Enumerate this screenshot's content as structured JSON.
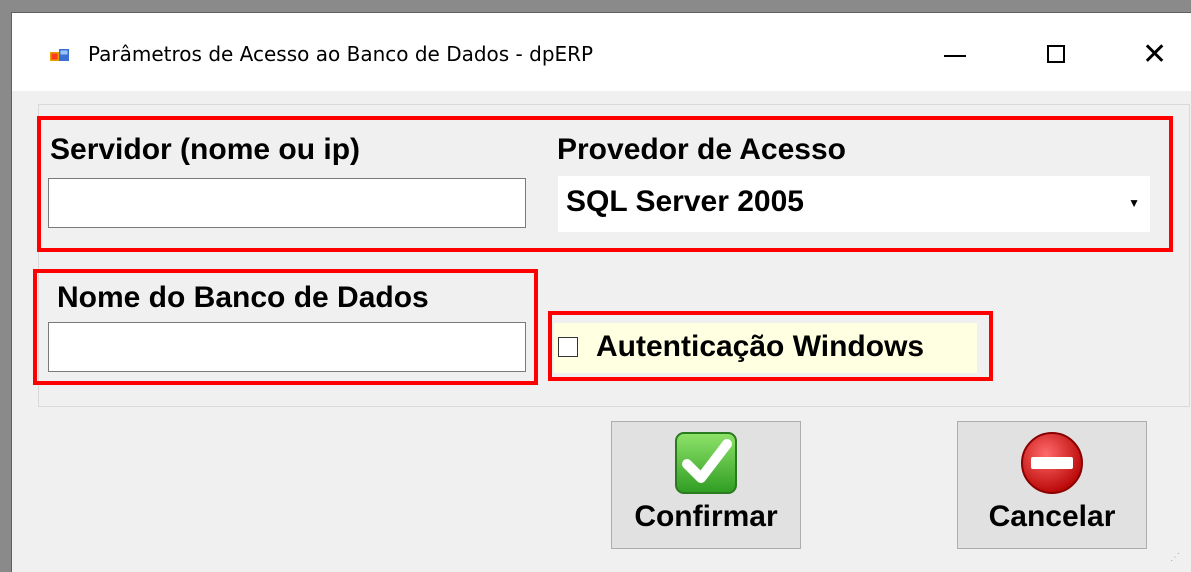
{
  "window": {
    "title": "Parâmetros de Acesso ao Banco de Dados - dpERP",
    "controls": {
      "minimize": "—",
      "maximize": "☐",
      "close": "✕"
    }
  },
  "form": {
    "servidor": {
      "label": "Servidor (nome ou ip)",
      "value": ""
    },
    "provedor": {
      "label": "Provedor de Acesso",
      "selected": "SQL Server 2005",
      "arrow": "▼"
    },
    "banco": {
      "label": "Nome do Banco de Dados",
      "value": ""
    },
    "autenticacao": {
      "label": "Autenticação Windows",
      "checked": false
    }
  },
  "buttons": {
    "confirm": {
      "label": "Confirmar",
      "icon": "checkmark-icon"
    },
    "cancel": {
      "label": "Cancelar",
      "icon": "no-entry-icon"
    }
  },
  "highlight_color": "#ff0000"
}
